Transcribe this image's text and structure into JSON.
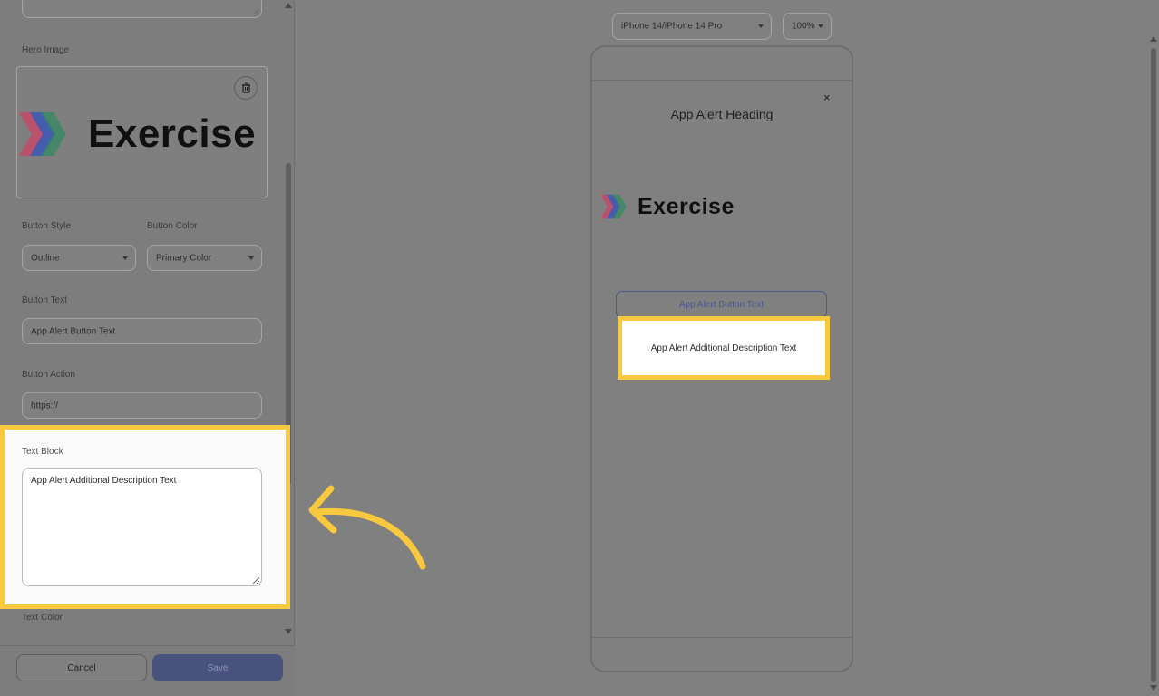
{
  "editor": {
    "hero_image_label": "Hero Image",
    "hero_logo_word": "Exercise",
    "button_style_label": "Button Style",
    "button_style_value": "Outline",
    "button_color_label": "Button Color",
    "button_color_value": "Primary Color",
    "button_text_label": "Button Text",
    "button_text_value": "App Alert Button Text",
    "button_action_label": "Button Action",
    "button_action_value": "https://",
    "text_block_label": "Text Block",
    "text_block_value": "App Alert Additional Description Text",
    "text_color_label": "Text Color"
  },
  "footer": {
    "cancel_label": "Cancel",
    "save_label": "Save"
  },
  "preview_toolbar": {
    "device_value": "iPhone 14/iPhone 14 Pro",
    "zoom_value": "100%"
  },
  "preview": {
    "close_glyph": "×",
    "heading": "App Alert Heading",
    "logo_word": "Exercise",
    "button_text": "App Alert Button Text",
    "description": "App Alert Additional Description Text"
  },
  "colors": {
    "highlight": "#f8c93e",
    "primary": "#4b5891",
    "overlay": "#808080"
  }
}
